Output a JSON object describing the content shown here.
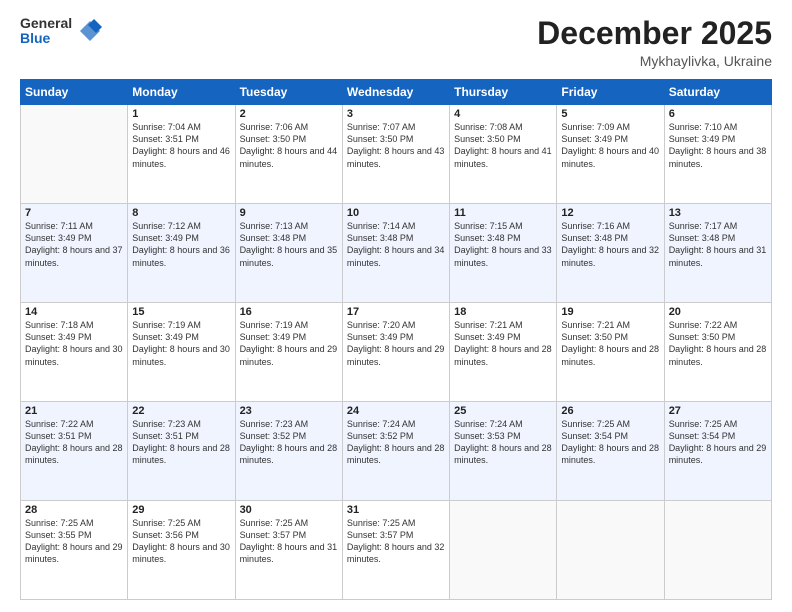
{
  "logo": {
    "general": "General",
    "blue": "Blue"
  },
  "title": {
    "month_year": "December 2025",
    "location": "Mykhaylivka, Ukraine"
  },
  "headers": [
    "Sunday",
    "Monday",
    "Tuesday",
    "Wednesday",
    "Thursday",
    "Friday",
    "Saturday"
  ],
  "weeks": [
    [
      {
        "day": "",
        "sunrise": "",
        "sunset": "",
        "daylight": ""
      },
      {
        "day": "1",
        "sunrise": "Sunrise: 7:04 AM",
        "sunset": "Sunset: 3:51 PM",
        "daylight": "Daylight: 8 hours and 46 minutes."
      },
      {
        "day": "2",
        "sunrise": "Sunrise: 7:06 AM",
        "sunset": "Sunset: 3:50 PM",
        "daylight": "Daylight: 8 hours and 44 minutes."
      },
      {
        "day": "3",
        "sunrise": "Sunrise: 7:07 AM",
        "sunset": "Sunset: 3:50 PM",
        "daylight": "Daylight: 8 hours and 43 minutes."
      },
      {
        "day": "4",
        "sunrise": "Sunrise: 7:08 AM",
        "sunset": "Sunset: 3:50 PM",
        "daylight": "Daylight: 8 hours and 41 minutes."
      },
      {
        "day": "5",
        "sunrise": "Sunrise: 7:09 AM",
        "sunset": "Sunset: 3:49 PM",
        "daylight": "Daylight: 8 hours and 40 minutes."
      },
      {
        "day": "6",
        "sunrise": "Sunrise: 7:10 AM",
        "sunset": "Sunset: 3:49 PM",
        "daylight": "Daylight: 8 hours and 38 minutes."
      }
    ],
    [
      {
        "day": "7",
        "sunrise": "Sunrise: 7:11 AM",
        "sunset": "Sunset: 3:49 PM",
        "daylight": "Daylight: 8 hours and 37 minutes."
      },
      {
        "day": "8",
        "sunrise": "Sunrise: 7:12 AM",
        "sunset": "Sunset: 3:49 PM",
        "daylight": "Daylight: 8 hours and 36 minutes."
      },
      {
        "day": "9",
        "sunrise": "Sunrise: 7:13 AM",
        "sunset": "Sunset: 3:48 PM",
        "daylight": "Daylight: 8 hours and 35 minutes."
      },
      {
        "day": "10",
        "sunrise": "Sunrise: 7:14 AM",
        "sunset": "Sunset: 3:48 PM",
        "daylight": "Daylight: 8 hours and 34 minutes."
      },
      {
        "day": "11",
        "sunrise": "Sunrise: 7:15 AM",
        "sunset": "Sunset: 3:48 PM",
        "daylight": "Daylight: 8 hours and 33 minutes."
      },
      {
        "day": "12",
        "sunrise": "Sunrise: 7:16 AM",
        "sunset": "Sunset: 3:48 PM",
        "daylight": "Daylight: 8 hours and 32 minutes."
      },
      {
        "day": "13",
        "sunrise": "Sunrise: 7:17 AM",
        "sunset": "Sunset: 3:48 PM",
        "daylight": "Daylight: 8 hours and 31 minutes."
      }
    ],
    [
      {
        "day": "14",
        "sunrise": "Sunrise: 7:18 AM",
        "sunset": "Sunset: 3:49 PM",
        "daylight": "Daylight: 8 hours and 30 minutes."
      },
      {
        "day": "15",
        "sunrise": "Sunrise: 7:19 AM",
        "sunset": "Sunset: 3:49 PM",
        "daylight": "Daylight: 8 hours and 30 minutes."
      },
      {
        "day": "16",
        "sunrise": "Sunrise: 7:19 AM",
        "sunset": "Sunset: 3:49 PM",
        "daylight": "Daylight: 8 hours and 29 minutes."
      },
      {
        "day": "17",
        "sunrise": "Sunrise: 7:20 AM",
        "sunset": "Sunset: 3:49 PM",
        "daylight": "Daylight: 8 hours and 29 minutes."
      },
      {
        "day": "18",
        "sunrise": "Sunrise: 7:21 AM",
        "sunset": "Sunset: 3:49 PM",
        "daylight": "Daylight: 8 hours and 28 minutes."
      },
      {
        "day": "19",
        "sunrise": "Sunrise: 7:21 AM",
        "sunset": "Sunset: 3:50 PM",
        "daylight": "Daylight: 8 hours and 28 minutes."
      },
      {
        "day": "20",
        "sunrise": "Sunrise: 7:22 AM",
        "sunset": "Sunset: 3:50 PM",
        "daylight": "Daylight: 8 hours and 28 minutes."
      }
    ],
    [
      {
        "day": "21",
        "sunrise": "Sunrise: 7:22 AM",
        "sunset": "Sunset: 3:51 PM",
        "daylight": "Daylight: 8 hours and 28 minutes."
      },
      {
        "day": "22",
        "sunrise": "Sunrise: 7:23 AM",
        "sunset": "Sunset: 3:51 PM",
        "daylight": "Daylight: 8 hours and 28 minutes."
      },
      {
        "day": "23",
        "sunrise": "Sunrise: 7:23 AM",
        "sunset": "Sunset: 3:52 PM",
        "daylight": "Daylight: 8 hours and 28 minutes."
      },
      {
        "day": "24",
        "sunrise": "Sunrise: 7:24 AM",
        "sunset": "Sunset: 3:52 PM",
        "daylight": "Daylight: 8 hours and 28 minutes."
      },
      {
        "day": "25",
        "sunrise": "Sunrise: 7:24 AM",
        "sunset": "Sunset: 3:53 PM",
        "daylight": "Daylight: 8 hours and 28 minutes."
      },
      {
        "day": "26",
        "sunrise": "Sunrise: 7:25 AM",
        "sunset": "Sunset: 3:54 PM",
        "daylight": "Daylight: 8 hours and 28 minutes."
      },
      {
        "day": "27",
        "sunrise": "Sunrise: 7:25 AM",
        "sunset": "Sunset: 3:54 PM",
        "daylight": "Daylight: 8 hours and 29 minutes."
      }
    ],
    [
      {
        "day": "28",
        "sunrise": "Sunrise: 7:25 AM",
        "sunset": "Sunset: 3:55 PM",
        "daylight": "Daylight: 8 hours and 29 minutes."
      },
      {
        "day": "29",
        "sunrise": "Sunrise: 7:25 AM",
        "sunset": "Sunset: 3:56 PM",
        "daylight": "Daylight: 8 hours and 30 minutes."
      },
      {
        "day": "30",
        "sunrise": "Sunrise: 7:25 AM",
        "sunset": "Sunset: 3:57 PM",
        "daylight": "Daylight: 8 hours and 31 minutes."
      },
      {
        "day": "31",
        "sunrise": "Sunrise: 7:25 AM",
        "sunset": "Sunset: 3:57 PM",
        "daylight": "Daylight: 8 hours and 32 minutes."
      },
      {
        "day": "",
        "sunrise": "",
        "sunset": "",
        "daylight": ""
      },
      {
        "day": "",
        "sunrise": "",
        "sunset": "",
        "daylight": ""
      },
      {
        "day": "",
        "sunrise": "",
        "sunset": "",
        "daylight": ""
      }
    ]
  ]
}
